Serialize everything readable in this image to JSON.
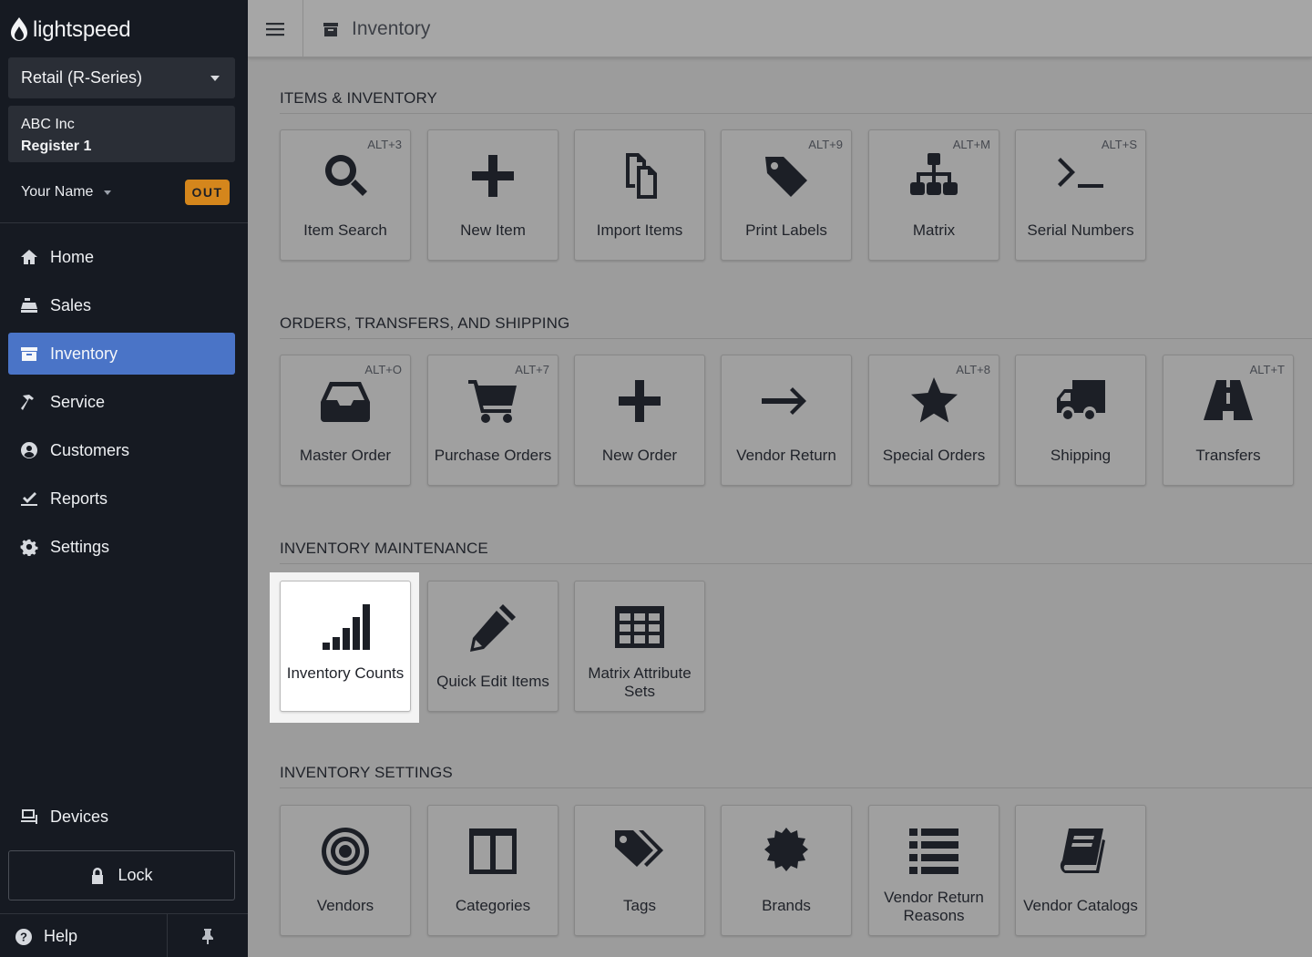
{
  "sidebar": {
    "logo_text": "lightspeed",
    "store": "Retail (R-Series)",
    "company": "ABC Inc",
    "register": "Register 1",
    "user_name": "Your Name",
    "status_badge": "OUT",
    "nav": [
      {
        "label": "Home",
        "icon": "home-icon"
      },
      {
        "label": "Sales",
        "icon": "register-icon"
      },
      {
        "label": "Inventory",
        "icon": "archive-icon",
        "active": true
      },
      {
        "label": "Service",
        "icon": "hammer-icon"
      },
      {
        "label": "Customers",
        "icon": "user-circle-icon"
      },
      {
        "label": "Reports",
        "icon": "chart-check-icon"
      },
      {
        "label": "Settings",
        "icon": "gear-icon"
      }
    ],
    "devices": "Devices",
    "lock": "Lock",
    "help": "Help"
  },
  "header": {
    "title": "Inventory"
  },
  "sections": [
    {
      "title": "ITEMS & INVENTORY",
      "tiles": [
        {
          "label": "Item Search",
          "shortcut": "ALT+3",
          "icon": "search-icon"
        },
        {
          "label": "New Item",
          "shortcut": "",
          "icon": "plus-icon"
        },
        {
          "label": "Import Items",
          "shortcut": "",
          "icon": "copy-icon"
        },
        {
          "label": "Print Labels",
          "shortcut": "ALT+9",
          "icon": "tag-icon"
        },
        {
          "label": "Matrix",
          "shortcut": "ALT+M",
          "icon": "sitemap-icon"
        },
        {
          "label": "Serial Numbers",
          "shortcut": "ALT+S",
          "icon": "terminal-icon"
        }
      ]
    },
    {
      "title": "ORDERS, TRANSFERS, AND SHIPPING",
      "tiles": [
        {
          "label": "Master Order",
          "shortcut": "ALT+O",
          "icon": "inbox-icon"
        },
        {
          "label": "Purchase Orders",
          "shortcut": "ALT+7",
          "icon": "cart-icon"
        },
        {
          "label": "New Order",
          "shortcut": "",
          "icon": "plus-icon"
        },
        {
          "label": "Vendor Return",
          "shortcut": "",
          "icon": "arrow-right-icon"
        },
        {
          "label": "Special Orders",
          "shortcut": "ALT+8",
          "icon": "star-icon"
        },
        {
          "label": "Shipping",
          "shortcut": "",
          "icon": "truck-icon"
        },
        {
          "label": "Transfers",
          "shortcut": "ALT+T",
          "icon": "road-icon"
        }
      ]
    },
    {
      "title": "INVENTORY MAINTENANCE",
      "tiles": [
        {
          "label": "Inventory Counts",
          "shortcut": "",
          "icon": "signal-bars-icon",
          "highlighted": true
        },
        {
          "label": "Quick Edit Items",
          "shortcut": "",
          "icon": "pencil-icon"
        },
        {
          "label": "Matrix Attribute Sets",
          "shortcut": "",
          "icon": "table-icon"
        }
      ]
    },
    {
      "title": "INVENTORY SETTINGS",
      "tiles": [
        {
          "label": "Vendors",
          "shortcut": "",
          "icon": "bullseye-icon"
        },
        {
          "label": "Categories",
          "shortcut": "",
          "icon": "columns-icon"
        },
        {
          "label": "Tags",
          "shortcut": "",
          "icon": "tags-icon"
        },
        {
          "label": "Brands",
          "shortcut": "",
          "icon": "certificate-icon"
        },
        {
          "label": "Vendor Return Reasons",
          "shortcut": "",
          "icon": "list-icon"
        },
        {
          "label": "Vendor Catalogs",
          "shortcut": "",
          "icon": "book-icon"
        }
      ]
    }
  ]
}
